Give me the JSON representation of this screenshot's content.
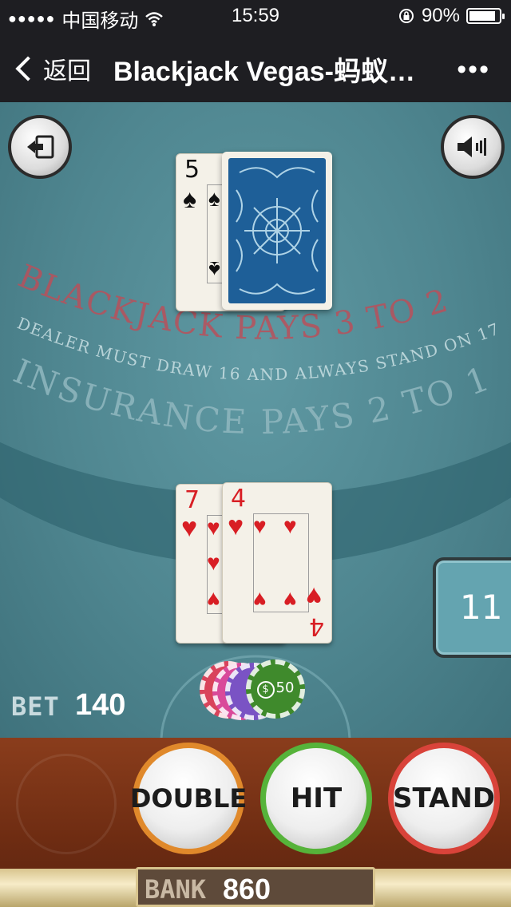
{
  "status_bar": {
    "signal_dots": "●●●●●",
    "carrier": "中国移动",
    "time": "15:59",
    "battery": "90%",
    "battery_level": 0.9
  },
  "nav": {
    "back_label": "返回",
    "title": "Blackjack Vegas-蚂蚁…",
    "more": "•••"
  },
  "table": {
    "line1": "BLACKJACK PAYS 3 TO 2",
    "line2": "DEALER MUST DRAW 16 AND ALWAYS STAND ON 17",
    "line3": "INSURANCE PAYS 2 TO 1",
    "dealer_card": {
      "rank": "5",
      "suit": "♠"
    },
    "player_cards": [
      {
        "rank": "7",
        "suit": "♥"
      },
      {
        "rank": "4",
        "suit": "♥"
      }
    ],
    "player_score": "11",
    "bet_label": "BET",
    "bet_value": "140",
    "top_chip_value": "50"
  },
  "controls": {
    "double_label": "DOUBLE",
    "hit_label": "HIT",
    "stand_label": "STAND",
    "bank_label": "BANK",
    "bank_value": "860"
  }
}
